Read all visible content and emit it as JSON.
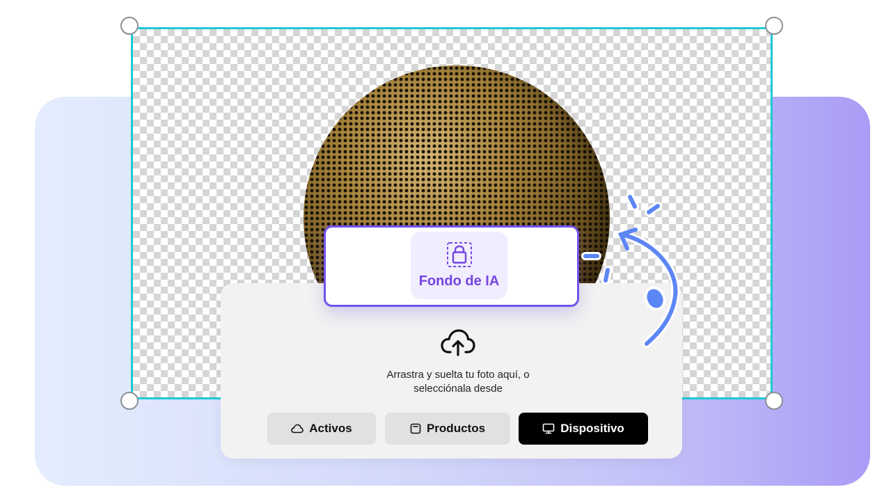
{
  "popup": {
    "label": "Fondo de IA",
    "icon": "ai-background-bag-icon"
  },
  "upload": {
    "icon": "cloud-upload-icon",
    "text_line1": "Arrastra y suelta tu foto aquí, o",
    "text_line2": "selecciónala desde"
  },
  "buttons": {
    "assets": {
      "label": "Activos",
      "icon": "cloud-icon"
    },
    "products": {
      "label": "Productos",
      "icon": "product-box-icon"
    },
    "device": {
      "label": "Dispositivo",
      "icon": "monitor-icon"
    }
  },
  "colors": {
    "accent": "#7252ec",
    "selection_border": "#1ec8d6",
    "arrow": "#5d86f5",
    "device_button": "#000000"
  }
}
